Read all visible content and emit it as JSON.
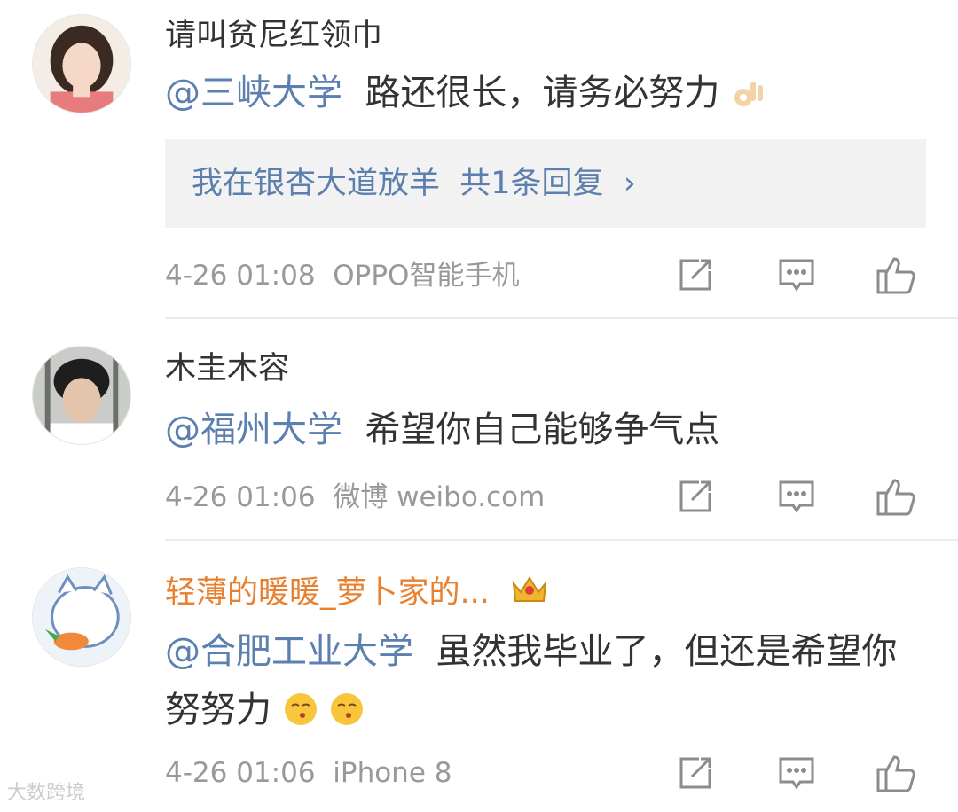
{
  "comments": [
    {
      "username": "请叫贫尼红领巾",
      "mention": "@三峡大学",
      "text": "路还很长，请务必努力",
      "emoji_icon": "ok-hand-icon",
      "reply": {
        "user": "我在银杏大道放羊",
        "summary": "共1条回复",
        "chevron": "›"
      },
      "time": "4-26 01:08",
      "source": "OPPO智能手机"
    },
    {
      "username": "木圭木容",
      "mention": "@福州大学",
      "text": "希望你自己能够争气点",
      "time": "4-26 01:06",
      "source": "微博 weibo.com"
    },
    {
      "username": "轻薄的暖暖_萝卜家的...",
      "badge_icon": "crown-icon",
      "mention": "@合肥工业大学",
      "text": "虽然我毕业了，但还是希望你努努力",
      "emoji_icon": "kiss-face-icon",
      "time": "4-26 01:06",
      "source": "iPhone 8"
    }
  ],
  "actions": {
    "repost_icon": "repost-icon",
    "comment_icon": "comment-icon",
    "like_icon": "thumbs-up-icon"
  },
  "watermark": "大数跨境",
  "colors": {
    "mention": "#5b7fae",
    "username_vip": "#e8802f",
    "meta": "#999999",
    "reply_bg": "#f2f2f2"
  }
}
